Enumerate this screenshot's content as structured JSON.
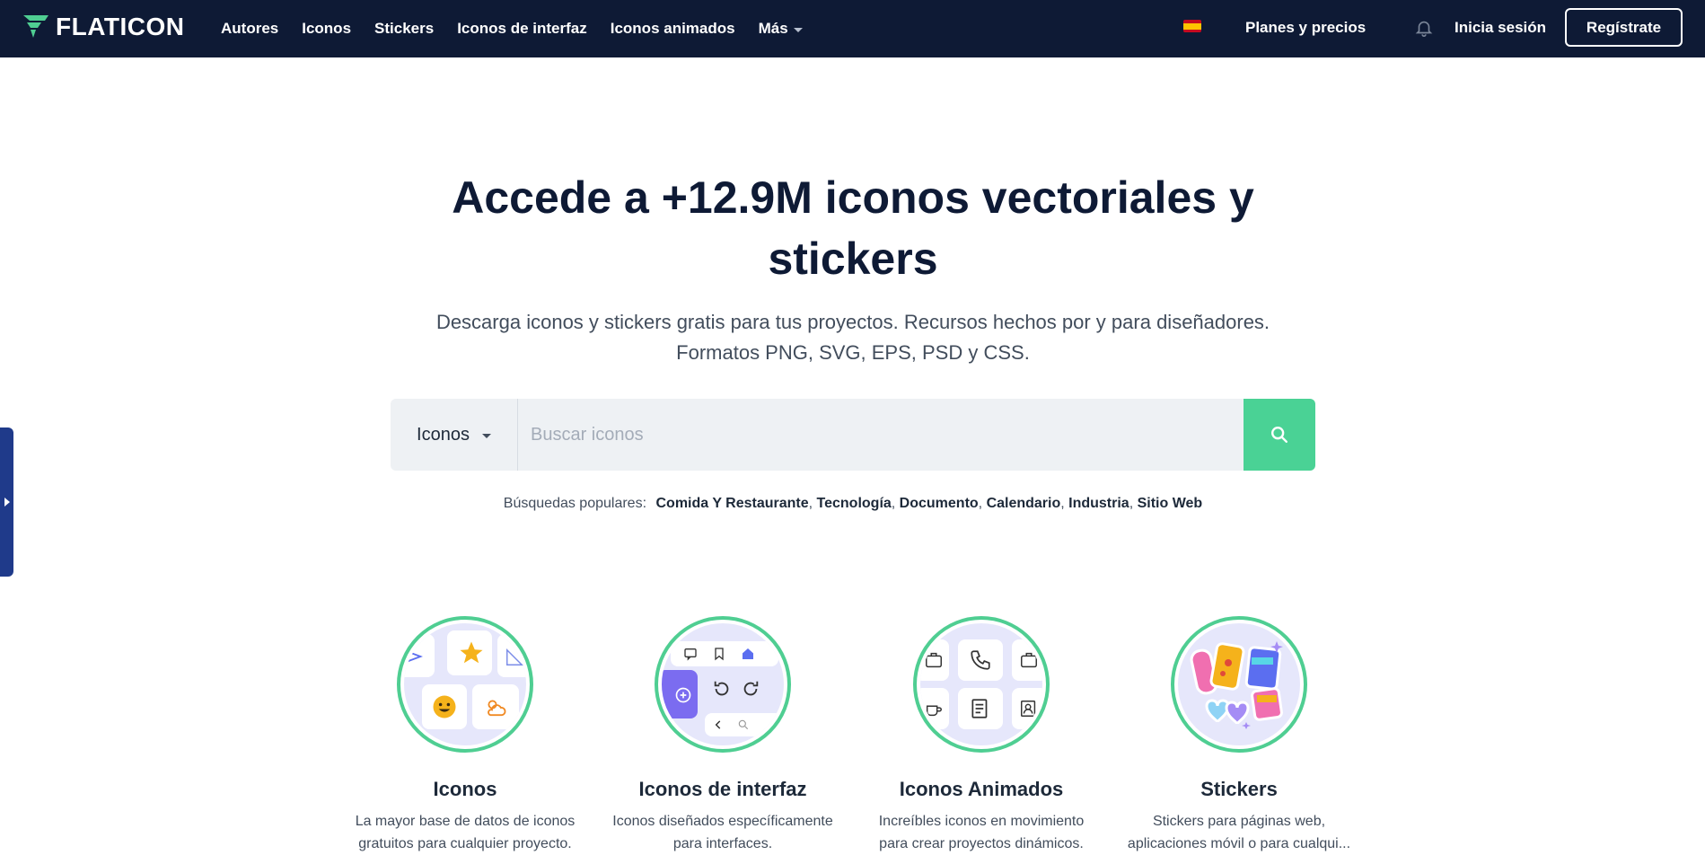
{
  "header": {
    "brand": "FLATICON",
    "nav": [
      "Autores",
      "Iconos",
      "Stickers",
      "Iconos de interfaz",
      "Iconos animados",
      "Más"
    ],
    "plans": "Planes y precios",
    "login": "Inicia sesión",
    "register": "Regístrate"
  },
  "hero": {
    "title_line1": "Accede a +12.9M iconos vectoriales y",
    "title_line2": "stickers",
    "subtitle_line1": "Descarga iconos y stickers gratis para tus proyectos. Recursos hechos por y para diseñadores.",
    "subtitle_line2": "Formatos PNG, SVG, EPS, PSD y CSS."
  },
  "search": {
    "type": "Iconos",
    "placeholder": "Buscar iconos"
  },
  "popular": {
    "label": "Búsquedas populares:",
    "tags": [
      "Comida Y Restaurante",
      "Tecnología",
      "Documento",
      "Calendario",
      "Industria",
      "Sitio Web"
    ]
  },
  "categories": [
    {
      "title": "Iconos",
      "desc1": "La mayor base de datos de iconos",
      "desc2": "gratuitos para cualquier proyecto."
    },
    {
      "title": "Iconos de interfaz",
      "desc1": "Iconos diseñados específicamente",
      "desc2": "para interfaces."
    },
    {
      "title": "Iconos Animados",
      "desc1": "Increíbles iconos en movimiento",
      "desc2": "para crear proyectos dinámicos."
    },
    {
      "title": "Stickers",
      "desc1": "Stickers para páginas web,",
      "desc2": "aplicaciones móvil o para cualqui..."
    }
  ],
  "colors": {
    "header_bg": "#0e1a35",
    "accent_green": "#4ad295",
    "side_tab": "#1f3a8a"
  }
}
